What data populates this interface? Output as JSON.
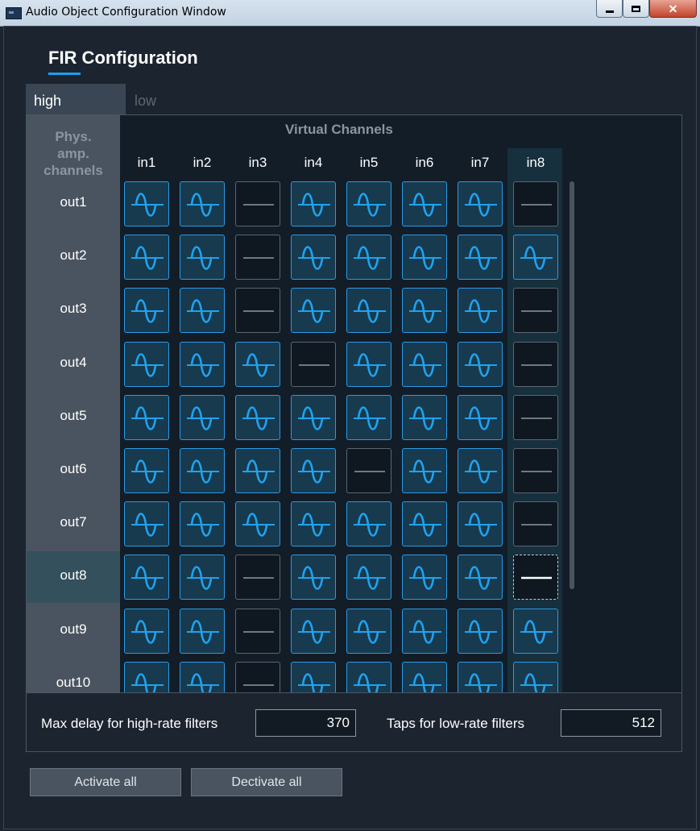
{
  "window": {
    "title": "Audio Object Configuration Window"
  },
  "heading": "FIR Configuration",
  "tabs": [
    {
      "label": "high",
      "active": true
    },
    {
      "label": "low",
      "active": false
    }
  ],
  "matrix": {
    "row_header_title": "Phys. amp. channels",
    "column_group_title": "Virtual Channels",
    "columns": [
      "in1",
      "in2",
      "in3",
      "in4",
      "in5",
      "in6",
      "in7",
      "in8"
    ],
    "rows": [
      "out1",
      "out2",
      "out3",
      "out4",
      "out5",
      "out6",
      "out7",
      "out8",
      "out9",
      "out10"
    ],
    "states": [
      [
        1,
        1,
        0,
        1,
        1,
        1,
        1,
        0
      ],
      [
        1,
        1,
        0,
        1,
        1,
        1,
        1,
        1
      ],
      [
        1,
        1,
        0,
        1,
        1,
        1,
        1,
        0
      ],
      [
        1,
        1,
        1,
        0,
        1,
        1,
        1,
        0
      ],
      [
        1,
        1,
        1,
        1,
        1,
        1,
        1,
        0
      ],
      [
        1,
        1,
        1,
        1,
        0,
        1,
        1,
        0
      ],
      [
        1,
        1,
        1,
        1,
        1,
        1,
        1,
        0
      ],
      [
        1,
        1,
        0,
        1,
        1,
        1,
        1,
        0
      ],
      [
        1,
        1,
        0,
        1,
        1,
        1,
        1,
        1
      ],
      [
        1,
        1,
        0,
        1,
        1,
        1,
        1,
        1
      ]
    ],
    "selected_row": "out8",
    "selected_column": "in8",
    "on_icon": "sine-wave-icon",
    "off_icon": "flat-line-icon",
    "colors": {
      "accent": "#2a9ae6",
      "wave": "#1fa3ef"
    }
  },
  "settings": {
    "max_delay_label": "Max delay for high-rate filters",
    "max_delay_value": "370",
    "taps_label": "Taps for low-rate filters",
    "taps_value": "512"
  },
  "buttons": {
    "activate_all": "Activate all",
    "deactivate_all": "Dectivate all"
  }
}
